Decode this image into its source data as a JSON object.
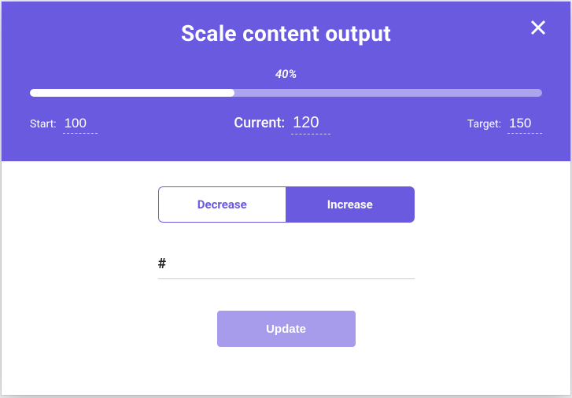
{
  "modal": {
    "title": "Scale content output",
    "progress": {
      "percent_label": "40%",
      "fill_width": "40%"
    },
    "values": {
      "start": {
        "label": "Start:",
        "value": "100"
      },
      "current": {
        "label": "Current:",
        "value": "120"
      },
      "target": {
        "label": "Target:",
        "value": "150"
      }
    },
    "toggle": {
      "decrease": "Decrease",
      "increase": "Increase"
    },
    "amount": {
      "prefix": "#",
      "value": ""
    },
    "update_label": "Update"
  }
}
